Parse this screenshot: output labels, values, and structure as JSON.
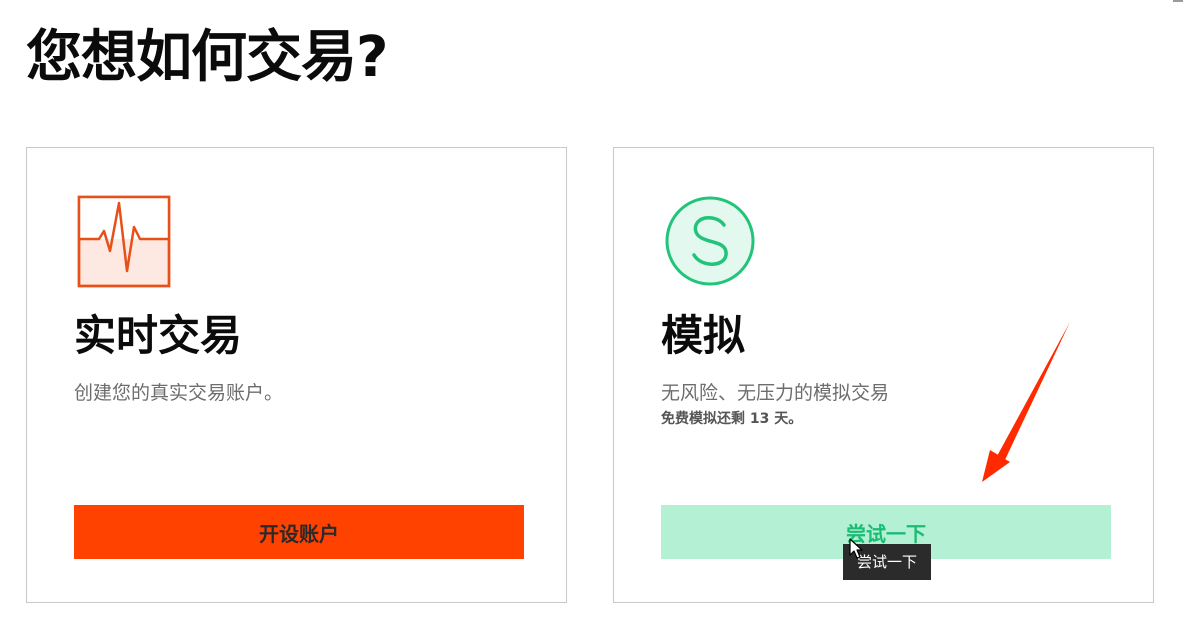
{
  "page": {
    "title": "您想如何交易?"
  },
  "cards": {
    "live": {
      "icon": "pulse-chart-icon",
      "title": "实时交易",
      "description": "创建您的真实交易账户。",
      "button_label": "开设账户",
      "accent_color": "#ff4200"
    },
    "demo": {
      "icon": "letter-s-circle-icon",
      "title": "模拟",
      "description": "无风险、无压力的模拟交易",
      "note": "免费模拟还剩 13 天。",
      "button_label": "尝试一下",
      "accent_color": "#1bbc74",
      "button_bg": "#b3f0d4"
    }
  },
  "tooltip": {
    "text": "尝试一下"
  },
  "annotation": {
    "icon": "red-arrow-icon",
    "color": "#ff2a00"
  }
}
